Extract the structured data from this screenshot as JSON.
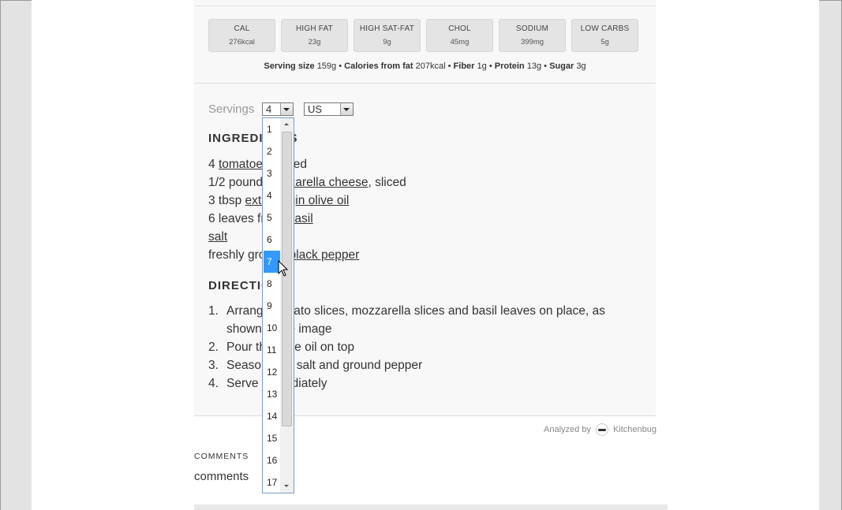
{
  "nutrition": [
    {
      "label": "CAL",
      "value": "276kcal"
    },
    {
      "label": "HIGH FAT",
      "value": "23g"
    },
    {
      "label": "HIGH SAT-FAT",
      "value": "9g"
    },
    {
      "label": "CHOL",
      "value": "45mg"
    },
    {
      "label": "SODIUM",
      "value": "399mg"
    },
    {
      "label": "LOW CARBS",
      "value": "5g"
    }
  ],
  "serving_info": {
    "serving_size_label": "Serving size",
    "serving_size": "159g",
    "cal_fat_label": "Calories from fat",
    "cal_fat": "207kcal",
    "fiber_label": "Fiber",
    "fiber": "1g",
    "protein_label": "Protein",
    "protein": "13g",
    "sugar_label": "Sugar",
    "sugar": "3g",
    "sep": "•"
  },
  "servings": {
    "label": "Servings",
    "selected": "4",
    "units": "US"
  },
  "ingredients": {
    "heading": "INGREDIENTS",
    "lines": [
      {
        "pre": "4 ",
        "link": "tomatoes",
        "post": ", sliced"
      },
      {
        "pre": "1/2 pound ",
        "link": "mozzarella cheese",
        "post": ", sliced"
      },
      {
        "pre": "3 tbsp ",
        "link": "extra virgin olive oil",
        "post": ""
      },
      {
        "pre": "6 leaves fresh ",
        "link": "basil",
        "post": ""
      },
      {
        "pre": "",
        "link": "salt",
        "post": ""
      },
      {
        "pre": "freshly ground ",
        "link": "black pepper",
        "post": ""
      }
    ]
  },
  "directions": {
    "heading": "DIRECTIONS",
    "steps": [
      {
        "num": "1.",
        "text": "Arrange tomato slices, mozzarella slices and basil leaves on place, as shown in the image"
      },
      {
        "num": "2.",
        "text": "Pour the olive oil on top"
      },
      {
        "num": "3.",
        "text": "Season with salt and ground pepper"
      },
      {
        "num": "4.",
        "text": "Serve immediately"
      }
    ]
  },
  "analyzed_by": {
    "label": "Analyzed by",
    "brand": "Kitchenbug",
    "icon": "mustache-icon"
  },
  "comments": {
    "heading": "COMMENTS",
    "text": "comments"
  },
  "dropdown": {
    "options": [
      "1",
      "2",
      "3",
      "4",
      "5",
      "6",
      "7",
      "8",
      "9",
      "10",
      "11",
      "12",
      "13",
      "14",
      "15",
      "16",
      "17"
    ],
    "highlighted": "7"
  },
  "colors": {
    "highlight": "#3399ff",
    "panel": "#f8f8f8",
    "badge": "#e4e4e4"
  }
}
